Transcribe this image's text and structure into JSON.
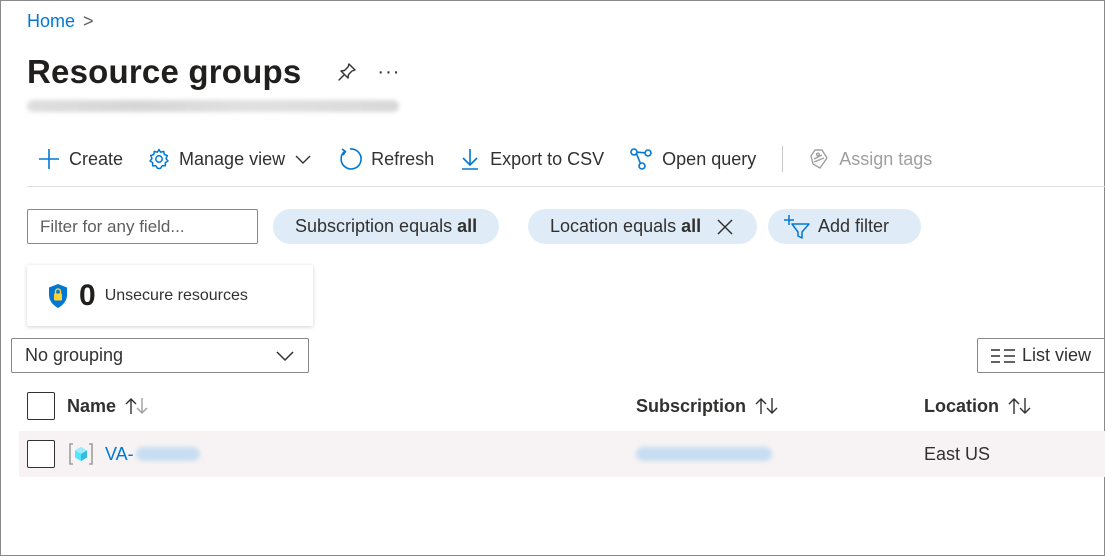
{
  "breadcrumb": {
    "home": "Home",
    "separator": ">"
  },
  "header": {
    "title": "Resource groups",
    "more": "···"
  },
  "toolbar": {
    "create": "Create",
    "manage_view": "Manage view",
    "refresh": "Refresh",
    "export": "Export to CSV",
    "open_query": "Open query",
    "assign_tags": "Assign tags"
  },
  "filters": {
    "placeholder": "Filter for any field...",
    "subscription_prefix": "Subscription equals",
    "subscription_value": "all",
    "location_prefix": "Location equals",
    "location_value": "all",
    "add_filter": "Add filter"
  },
  "security": {
    "count": "0",
    "label": "Unsecure resources"
  },
  "grouping": {
    "selected": "No grouping"
  },
  "view": {
    "label": "List view"
  },
  "table": {
    "columns": {
      "name": "Name",
      "subscription": "Subscription",
      "location": "Location"
    },
    "rows": [
      {
        "name": "VA-",
        "location": "East US"
      }
    ]
  },
  "colors": {
    "accent": "#0078d4",
    "pill": "#dfecf8",
    "row_hover": "#f7f3f4"
  }
}
